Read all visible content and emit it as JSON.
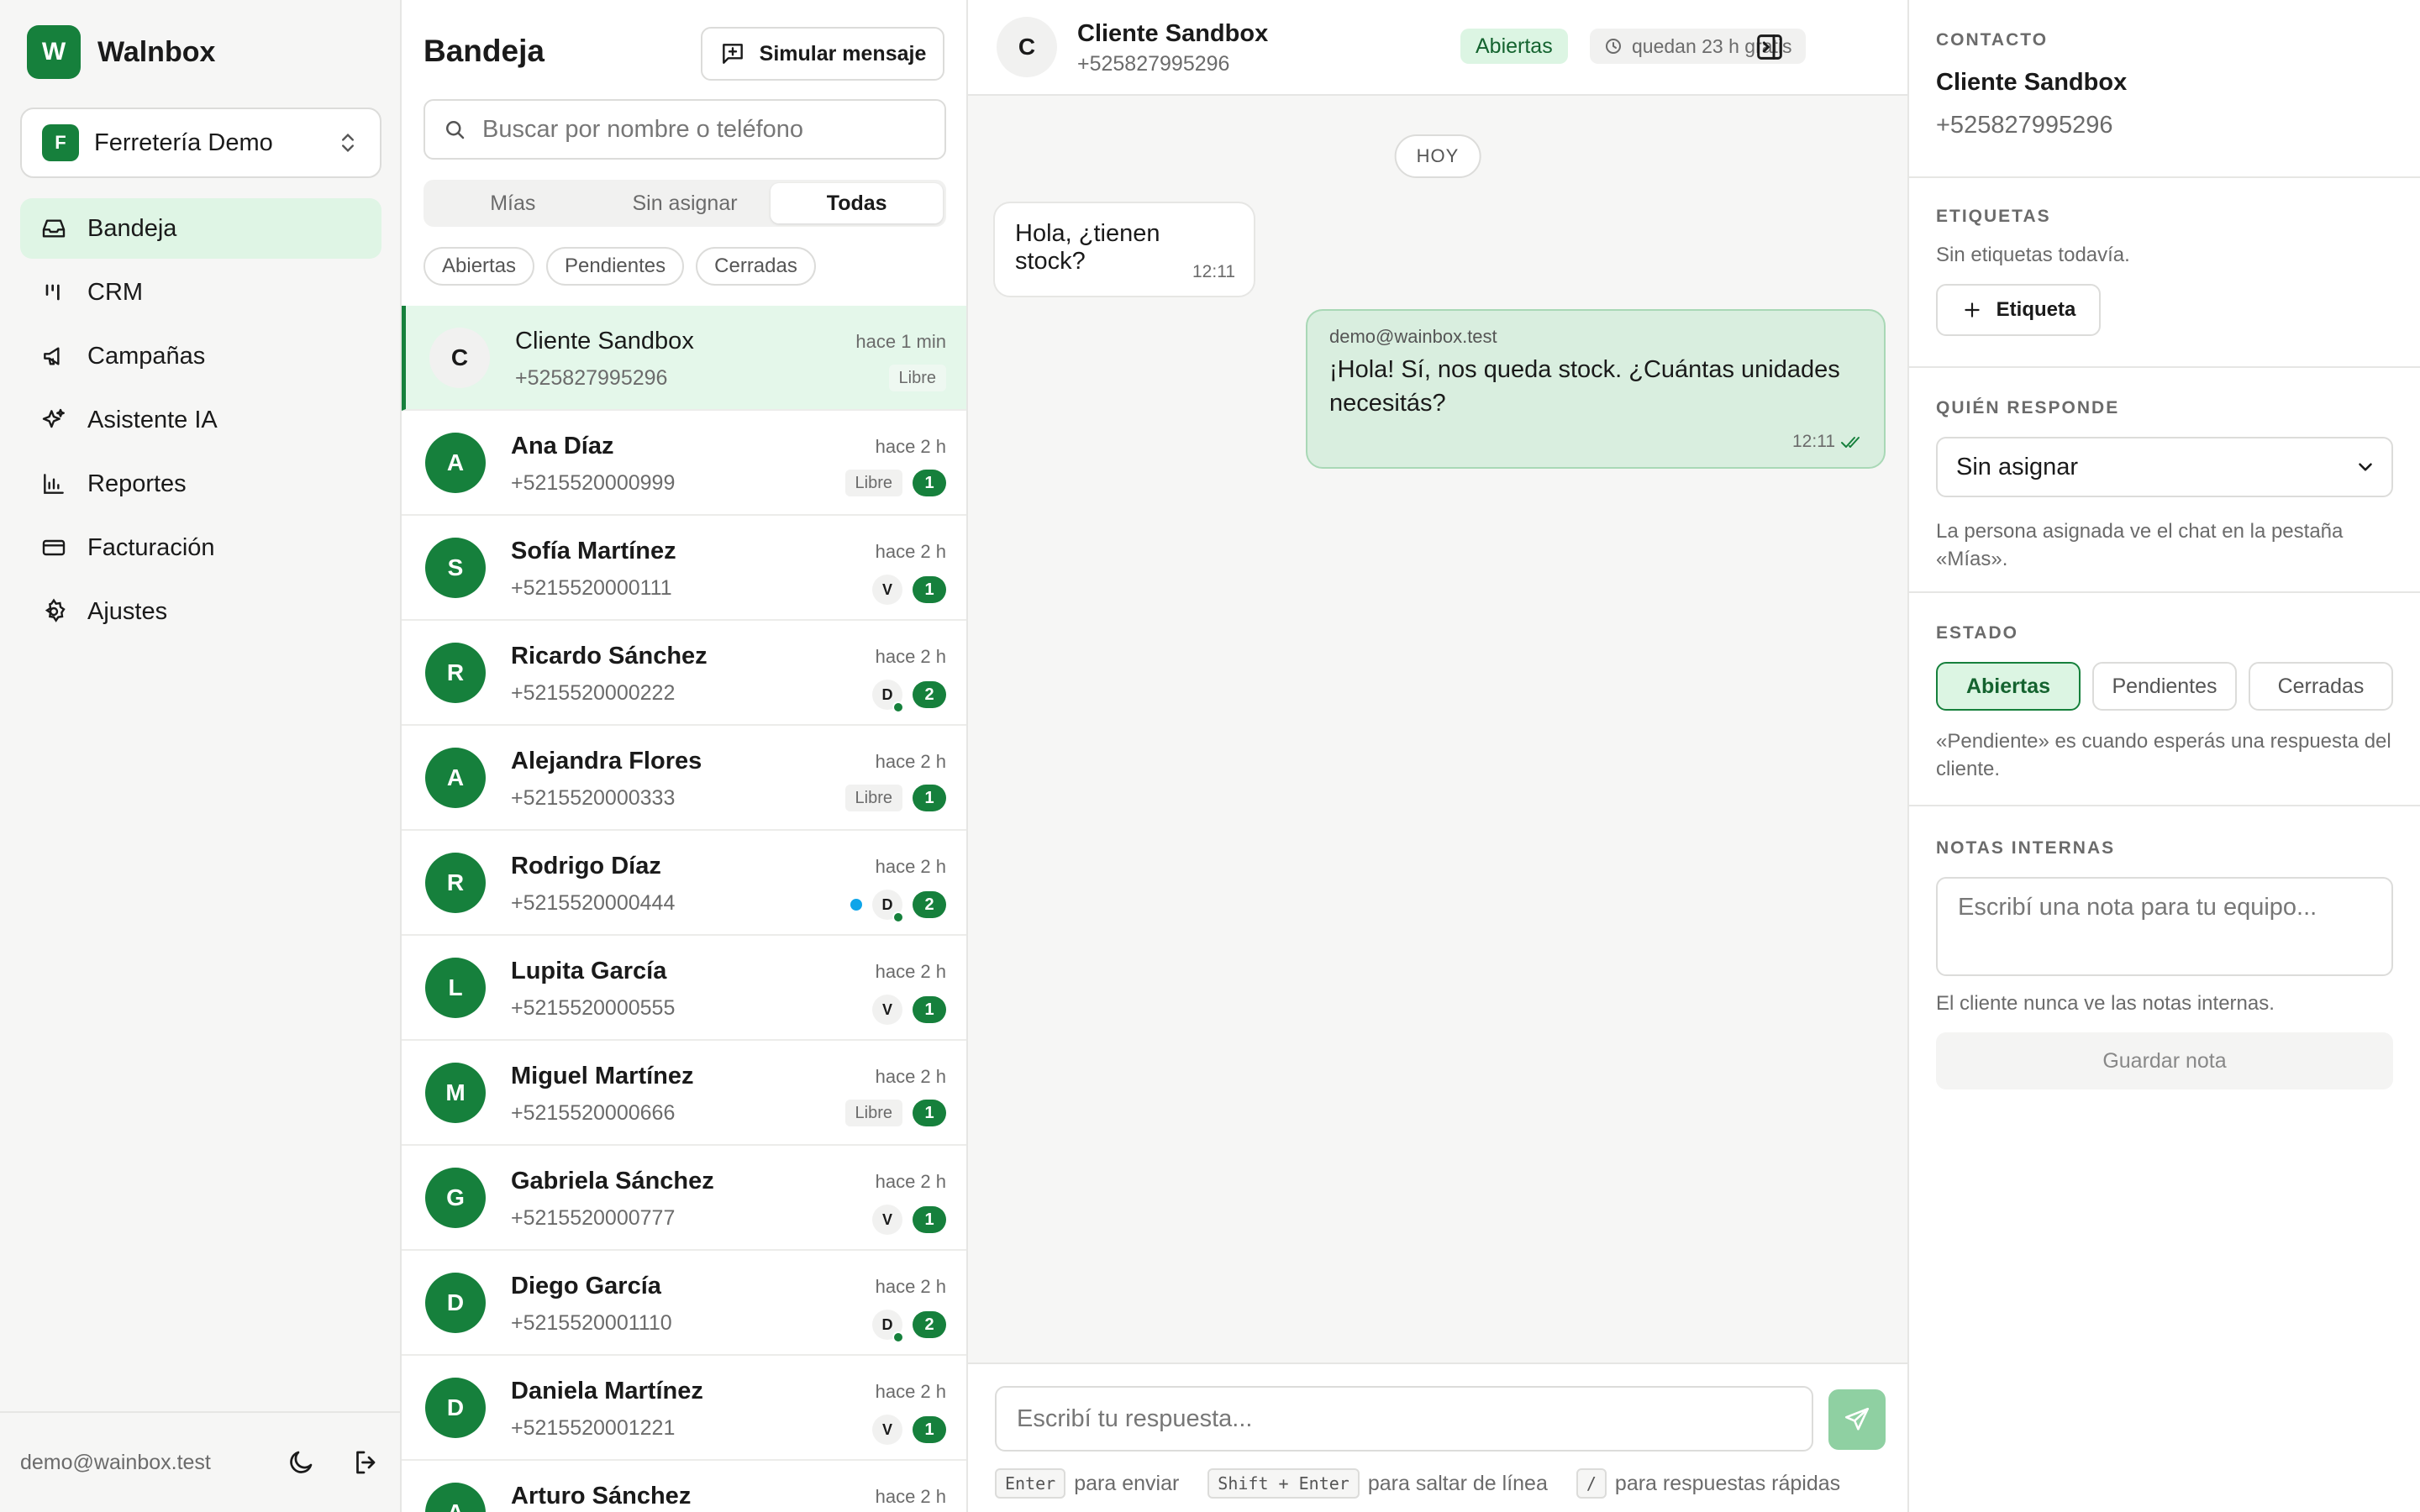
{
  "sidebar": {
    "brand": {
      "logo_letter": "W",
      "name": "Walnbox"
    },
    "workspace": {
      "badge": "F",
      "name": "Ferretería Demo"
    },
    "nav": [
      {
        "label": "Bandeja",
        "icon": "inbox-icon",
        "active": true
      },
      {
        "label": "CRM",
        "icon": "kanban-icon",
        "active": false
      },
      {
        "label": "Campañas",
        "icon": "megaphone-icon",
        "active": false
      },
      {
        "label": "Asistente IA",
        "icon": "sparkles-icon",
        "active": false
      },
      {
        "label": "Reportes",
        "icon": "bar-chart-icon",
        "active": false
      },
      {
        "label": "Facturación",
        "icon": "credit-card-icon",
        "active": false
      },
      {
        "label": "Ajustes",
        "icon": "gear-icon",
        "active": false
      }
    ],
    "footer": {
      "email": "demo@wainbox.test"
    }
  },
  "inbox": {
    "title": "Bandeja",
    "simulate_label": "Simular mensaje",
    "search_placeholder": "Buscar por nombre o teléfono",
    "tabs": [
      {
        "label": "Mías",
        "active": false
      },
      {
        "label": "Sin asignar",
        "active": false
      },
      {
        "label": "Todas",
        "active": true
      }
    ],
    "filters": [
      "Abiertas",
      "Pendientes",
      "Cerradas"
    ],
    "conversations": [
      {
        "initial": "C",
        "name": "Cliente Sandbox",
        "phone": "+525827995296",
        "time": "hace 1 min",
        "libre": "Libre",
        "agent": "",
        "unread": "",
        "blue": false,
        "online": false,
        "active": true
      },
      {
        "initial": "A",
        "name": "Ana Díaz",
        "phone": "+5215520000999",
        "time": "hace 2 h",
        "libre": "Libre",
        "agent": "",
        "unread": "1",
        "blue": false,
        "online": false,
        "active": false
      },
      {
        "initial": "S",
        "name": "Sofía Martínez",
        "phone": "+5215520000111",
        "time": "hace 2 h",
        "libre": "",
        "agent": "V",
        "unread": "1",
        "blue": false,
        "online": false,
        "active": false
      },
      {
        "initial": "R",
        "name": "Ricardo Sánchez",
        "phone": "+5215520000222",
        "time": "hace 2 h",
        "libre": "",
        "agent": "D",
        "unread": "2",
        "blue": false,
        "online": true,
        "active": false
      },
      {
        "initial": "A",
        "name": "Alejandra Flores",
        "phone": "+5215520000333",
        "time": "hace 2 h",
        "libre": "Libre",
        "agent": "",
        "unread": "1",
        "blue": false,
        "online": false,
        "active": false
      },
      {
        "initial": "R",
        "name": "Rodrigo Díaz",
        "phone": "+5215520000444",
        "time": "hace 2 h",
        "libre": "",
        "agent": "D",
        "unread": "2",
        "blue": true,
        "online": true,
        "active": false
      },
      {
        "initial": "L",
        "name": "Lupita García",
        "phone": "+5215520000555",
        "time": "hace 2 h",
        "libre": "",
        "agent": "V",
        "unread": "1",
        "blue": false,
        "online": false,
        "active": false
      },
      {
        "initial": "M",
        "name": "Miguel Martínez",
        "phone": "+5215520000666",
        "time": "hace 2 h",
        "libre": "Libre",
        "agent": "",
        "unread": "1",
        "blue": false,
        "online": false,
        "active": false
      },
      {
        "initial": "G",
        "name": "Gabriela Sánchez",
        "phone": "+5215520000777",
        "time": "hace 2 h",
        "libre": "",
        "agent": "V",
        "unread": "1",
        "blue": false,
        "online": false,
        "active": false
      },
      {
        "initial": "D",
        "name": "Diego García",
        "phone": "+5215520001110",
        "time": "hace 2 h",
        "libre": "",
        "agent": "D",
        "unread": "2",
        "blue": false,
        "online": true,
        "active": false
      },
      {
        "initial": "D",
        "name": "Daniela Martínez",
        "phone": "+5215520001221",
        "time": "hace 2 h",
        "libre": "",
        "agent": "V",
        "unread": "1",
        "blue": false,
        "online": false,
        "active": false
      },
      {
        "initial": "A",
        "name": "Arturo Sánchez",
        "phone": "",
        "time": "hace 2 h",
        "libre": "",
        "agent": "",
        "unread": "",
        "blue": false,
        "online": false,
        "active": false
      }
    ]
  },
  "chat": {
    "avatar_initial": "C",
    "name": "Cliente Sandbox",
    "phone": "+525827995296",
    "status": "Abiertas",
    "window": "quedan 23 h gratis",
    "day": "HOY",
    "incoming": {
      "text": "Hola, ¿tienen stock?",
      "time": "12:11"
    },
    "outgoing": {
      "sender": "demo@wainbox.test",
      "text": "¡Hola! Sí, nos queda stock. ¿Cuántas unidades necesitás?",
      "time": "12:11"
    },
    "composer_placeholder": "Escribí tu respuesta...",
    "hints": {
      "enter_key": "Enter",
      "enter_text": "para enviar",
      "shift_key": "Shift + Enter",
      "shift_text": "para saltar de línea",
      "slash_key": "/",
      "slash_text": "para respuestas rápidas"
    }
  },
  "contact": {
    "contact_title": "CONTACTO",
    "name": "Cliente Sandbox",
    "phone": "+525827995296",
    "tags_title": "ETIQUETAS",
    "tags_empty": "Sin etiquetas todavía.",
    "tag_button": "Etiqueta",
    "assignee_title": "QUIÉN RESPONDE",
    "assignee_value": "Sin asignar",
    "assignee_help": "La persona asignada ve el chat en la pestaña «Mías».",
    "state_title": "ESTADO",
    "states": [
      {
        "label": "Abiertas",
        "active": true
      },
      {
        "label": "Pendientes",
        "active": false
      },
      {
        "label": "Cerradas",
        "active": false
      }
    ],
    "state_help": "«Pendiente» es cuando esperás una respuesta del cliente.",
    "notes_title": "NOTAS INTERNAS",
    "notes_placeholder": "Escribí una nota para tu equipo...",
    "notes_help": "El cliente nunca ve las notas internas.",
    "save_note": "Guardar nota"
  },
  "colors": {
    "brand": "#16803c",
    "active_bg": "#dff5e5",
    "unread": "#16803c",
    "info_dot": "#0ea5e9"
  }
}
